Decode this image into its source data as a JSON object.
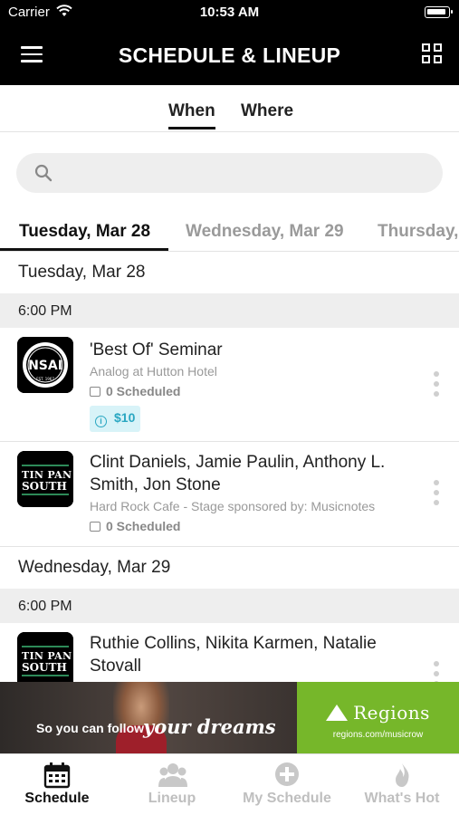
{
  "status_bar": {
    "carrier": "Carrier",
    "time": "10:53 AM"
  },
  "header": {
    "title": "SCHEDULE & LINEUP",
    "menu_icon": "hamburger-menu-icon",
    "grid_icon": "grid-view-icon"
  },
  "segments": [
    {
      "label": "When",
      "selected": true
    },
    {
      "label": "Where",
      "selected": false
    }
  ],
  "search": {
    "placeholder": ""
  },
  "day_tabs": [
    {
      "label": "Tuesday, Mar 28",
      "selected": true
    },
    {
      "label": "Wednesday, Mar 29",
      "selected": false
    },
    {
      "label": "Thursday,",
      "selected": false
    }
  ],
  "sections": [
    {
      "date": "Tuesday, Mar 28",
      "time": "6:00 PM",
      "events": [
        {
          "title": "'Best Of' Seminar",
          "venue": "Analog at Hutton Hotel",
          "scheduled": "0 Scheduled",
          "price": "$10",
          "logo_text": "NSAI",
          "logo_sub": "EST. 1967"
        },
        {
          "title": "Clint Daniels, Jamie Paulin, Anthony L. Smith, Jon Stone",
          "venue": "Hard Rock Cafe - Stage sponsored by: Musicnotes",
          "scheduled": "0 Scheduled",
          "logo_text_1": "TIN PAN",
          "logo_text_2": "SOUTH"
        }
      ]
    },
    {
      "date": "Wednesday, Mar 29",
      "time": "6:00 PM",
      "events": [
        {
          "title": "Ruthie Collins, Nikita Karmen, Natalie Stovall",
          "logo_text_1": "TIN PAN",
          "logo_text_2": "SOUTH"
        }
      ]
    }
  ],
  "banner": {
    "tagline_1": "So you can follow",
    "tagline_2": "your dreams",
    "brand": "Regions",
    "url": "regions.com/musicrow",
    "brand_color": "#76b72a"
  },
  "tab_bar": [
    {
      "label": "Schedule",
      "icon": "calendar-icon",
      "active": true
    },
    {
      "label": "Lineup",
      "icon": "people-icon",
      "active": false
    },
    {
      "label": "My Schedule",
      "icon": "plus-circle-icon",
      "active": false
    },
    {
      "label": "What's Hot",
      "icon": "flame-icon",
      "active": false
    }
  ]
}
